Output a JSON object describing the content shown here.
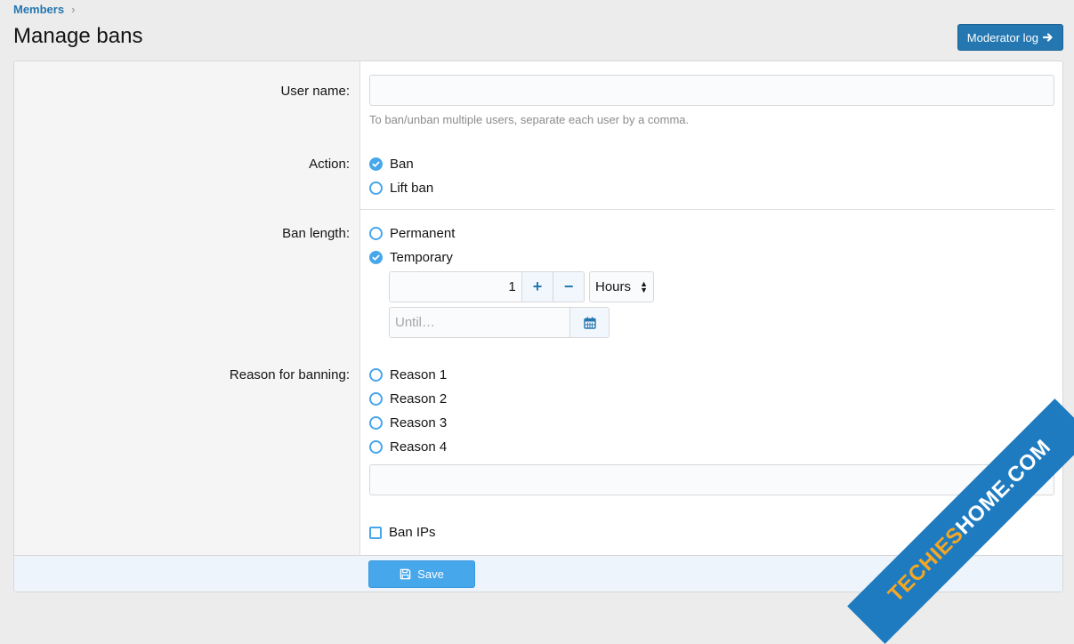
{
  "breadcrumb": {
    "label": "Members",
    "sep": "›"
  },
  "page": {
    "title": "Manage bans"
  },
  "header": {
    "moderator_log_label": "Moderator log"
  },
  "form": {
    "username": {
      "label": "User name:",
      "value": "",
      "hint": "To ban/unban multiple users, separate each user by a comma."
    },
    "action": {
      "label": "Action:",
      "options": [
        {
          "label": "Ban",
          "checked": true
        },
        {
          "label": "Lift ban",
          "checked": false
        }
      ]
    },
    "ban_length": {
      "label": "Ban length:",
      "options": [
        {
          "label": "Permanent",
          "checked": false
        },
        {
          "label": "Temporary",
          "checked": true
        }
      ],
      "amount": "1",
      "plus": "+",
      "minus": "−",
      "unit": "Hours",
      "until_placeholder": "Until…"
    },
    "reason": {
      "label": "Reason for banning:",
      "options": [
        {
          "label": "Reason 1",
          "checked": false
        },
        {
          "label": "Reason 2",
          "checked": false
        },
        {
          "label": "Reason 3",
          "checked": false
        },
        {
          "label": "Reason 4",
          "checked": false
        }
      ],
      "custom_value": ""
    },
    "ban_ips": {
      "label": "Ban IPs",
      "checked": false
    },
    "save_label": "Save"
  },
  "watermark": {
    "part1": "TECHIES",
    "part2": "HOME.COM"
  },
  "colors": {
    "accent": "#2577b1",
    "primary_button": "#47a7eb",
    "radio": "#47a7eb"
  }
}
